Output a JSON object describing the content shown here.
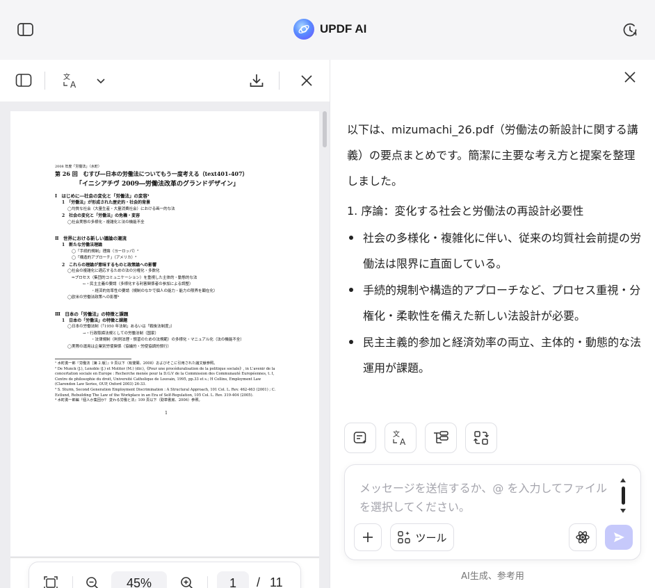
{
  "header": {
    "app_name": "UPDF AI"
  },
  "viewer": {
    "zoom": "45%",
    "page_current": "1",
    "page_separator": "/",
    "page_total": "11"
  },
  "document": {
    "meta": "2008 年度「労働法」（水町）",
    "lecture_title": "第 26 回　むすび―日本の労働法についてもう一度考える（text401-407）",
    "subtitle": "「イニシアチヴ 2009―労働法改革のグランドデザイン」",
    "sections": [
      {
        "t": "sec",
        "text": "Ⅰ　はじめに―社会の変化と「労働法」の変容¹"
      },
      {
        "t": "sub",
        "text": "1　「労働法」が形成された歴史的・社会的背景"
      },
      {
        "t": "it",
        "text": "◯均質な社会（大量生産・大量消費社会）における画一的な法"
      },
      {
        "t": "sub",
        "text": "2　社会の変化と「労働法」の危機・変容"
      },
      {
        "t": "it",
        "text": "◯社会実態の多様化・複雑化と法の機能不全"
      },
      {
        "t": "gap",
        "text": ""
      },
      {
        "t": "sec",
        "text": "Ⅱ　世界における新しい議論の潮流"
      },
      {
        "t": "sub",
        "text": "1　新たな労働法理論"
      },
      {
        "t": "it2",
        "text": "◯「手続的規制」理論（ヨーロッパ）²"
      },
      {
        "t": "it2",
        "text": "◯「構造的アプローチ」（アメリカ）³"
      },
      {
        "t": "sub",
        "text": "2　これらの理論が意味するものと政策論への影響"
      },
      {
        "t": "it",
        "text": "◯社会の複雑化に適応するための法の分権化・多数化"
      },
      {
        "t": "it2",
        "text": "⇒プロセス（集団的コミュニケーション）を重視した主体的・動態的な法"
      },
      {
        "t": "it3",
        "text": "←・民主主義の要請（多様化する利害関係者の参加による調整）"
      },
      {
        "t": "it4",
        "text": "・経済的効率性の要請（規制のなかで個人の能力・能力の限界を顕在化）"
      },
      {
        "t": "it",
        "text": "◯欧米の労働法政策への影響⁴"
      },
      {
        "t": "gap",
        "text": ""
      },
      {
        "t": "sec",
        "text": "Ⅲ　日本の「労働法」の特徴と課題"
      },
      {
        "t": "sub",
        "text": "1　日本の「労働法」の特徴と課題"
      },
      {
        "t": "it",
        "text": "◯日本の労働法制（「1950 年法制」あるいは「戦後法制度」）"
      },
      {
        "t": "it3",
        "text": "→・行政取締法規としての労働法制（国家）"
      },
      {
        "t": "it4",
        "text": "・法律規制（判例法理・慣習のための法規範）の多様化・マニュアル化（法の機能不全）"
      },
      {
        "t": "it",
        "text": "◯実際の運用は企業別労使関係（協議的・労使協調的慣行）"
      }
    ],
    "footnotes": [
      "¹ 水町勇一郎『労働法［第 2 版］』9 頁以下（有斐閣、2008）およびそこに引用された諸文献参照。",
      "² De Munck (J.), Lenoble (J.) et Molitor (M.) (dir.),《Pour une procéduralisation de la politique sociale》, in L'avenir de la concertation sociale en Europe : Recherche menée pour la D.G.V de la Commission des Communauté Européennes, t. I, Centre de philosophie du droit, Université Catholique de Louvain, 1995, pp.33 et s.; H Collins, Employment Law (Clarendon Law Series, OUP, Oxford 2003) 26-33.",
      "³ S. Sturm, Second Generation Employment Discrimination : A Structural Approach, 101 Col. L. Rev. 462-463 (2001) ; C. Estlund, Rebuilding The Law of the Workplace in an Era of Self-Regulation, 105 Col. L. Rev. 319-404 (2005).",
      "⁴ 水町勇一郎編『個人か集団か？ 変わる労働と法』109 頁以下（勁草書房、2006）参照。"
    ],
    "page_number": "1"
  },
  "chat": {
    "answer_intro": "以下は、mizumachi_26.pdf（労働法の新設計に関する講義）の要点まとめです。簡潔に主要な考え方と提案を整理しました。",
    "section_heading": "1. 序論：変化する社会と労働法の再設計必要性",
    "bullets": [
      "社会の多様化・複雑化に伴い、従来の均質社会前提の労働法は限界に直面している。",
      "手続的規制や構造的アプローチなど、プロセス重視・分権化・柔軟性を備えた新しい法設計が必要。",
      "民主主義的参加と経済効率の両立、主体的・動態的な法運用が課題。"
    ],
    "input_placeholder": "メッセージを送信するか、@ を入力してファイルを選択してください。",
    "tools_label": "ツール",
    "footer_note": "AI生成、参考用"
  }
}
